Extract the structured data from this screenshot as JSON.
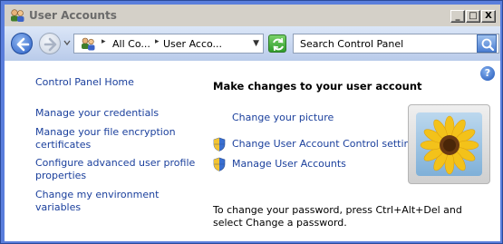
{
  "window": {
    "title": "User Accounts",
    "controls": {
      "minimize": "_",
      "maximize": "□",
      "close": "X"
    }
  },
  "addressbar": {
    "breadcrumb": [
      {
        "label": "All Co..."
      },
      {
        "label": "User Acco..."
      }
    ],
    "search_placeholder": "Search Control Panel"
  },
  "sidebar": {
    "home": "Control Panel Home",
    "links": [
      "Manage your credentials",
      "Manage your file encryption certificates",
      "Configure advanced user profile properties",
      "Change my environment variables"
    ]
  },
  "main": {
    "heading": "Make changes to your user account",
    "tasks": [
      {
        "label": "Change your picture",
        "icon": "none"
      },
      {
        "label": "Change User Account Control settings",
        "icon": "uac-shield-icon"
      },
      {
        "label": "Manage User Accounts",
        "icon": "uac-shield-icon"
      }
    ],
    "note": "To change your password, press Ctrl+Alt+Del and select Change a password."
  },
  "colors": {
    "link": "#1a3f9c",
    "frame": "#5a7edc",
    "title_text": "#6b6b6b"
  }
}
